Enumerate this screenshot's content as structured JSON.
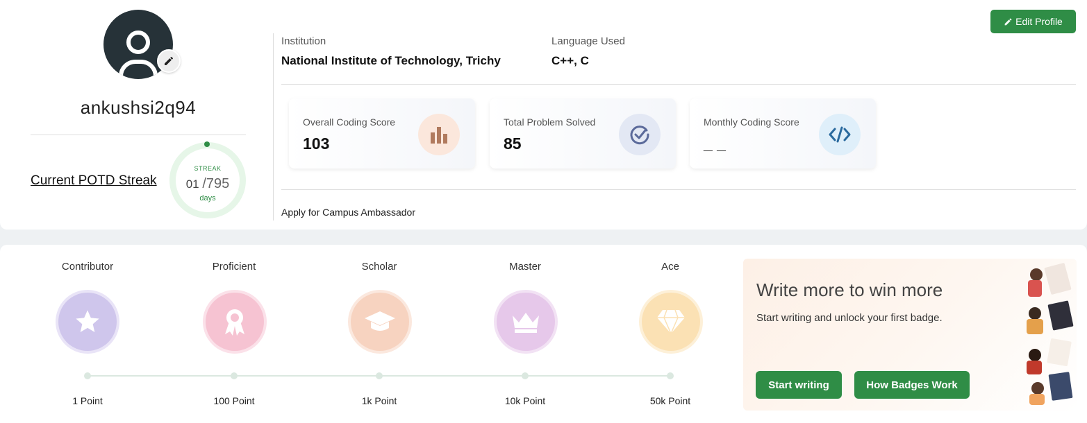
{
  "profile": {
    "username": "ankushsi2q94",
    "potd_label": "Current POTD Streak",
    "streak_label": "STREAK",
    "streak_current": "01",
    "streak_total": "/795",
    "streak_unit": "days"
  },
  "header": {
    "edit_profile_label": "Edit Profile"
  },
  "info": {
    "institution_label": "Institution",
    "institution_value": "National Institute of Technology, Trichy",
    "language_label": "Language Used",
    "language_value": "C++, C"
  },
  "stats": [
    {
      "label": "Overall Coding Score",
      "value": "103",
      "icon": "bar-chart-icon"
    },
    {
      "label": "Total Problem Solved",
      "value": "85",
      "icon": "check-circle-icon"
    },
    {
      "label": "Monthly Coding Score",
      "value": "_ _",
      "icon": "code-icon"
    }
  ],
  "campus_link": "Apply for Campus Ambassador",
  "badges": [
    {
      "name": "Contributor",
      "points": "1 Point",
      "icon": "star-icon",
      "color": "#cfc6ec"
    },
    {
      "name": "Proficient",
      "points": "100 Point",
      "icon": "ribbon-icon",
      "color": "#f6c3d2"
    },
    {
      "name": "Scholar",
      "points": "1k Point",
      "icon": "graduation-cap-icon",
      "color": "#f7d3c0"
    },
    {
      "name": "Master",
      "points": "10k Point",
      "icon": "crown-icon",
      "color": "#e6c8ea"
    },
    {
      "name": "Ace",
      "points": "50k Point",
      "icon": "diamond-icon",
      "color": "#fbe1b4"
    }
  ],
  "promo": {
    "title": "Write more to win more",
    "subtitle": "Start writing and unlock your first badge.",
    "start_writing_label": "Start writing",
    "how_badges_label": "How Badges Work"
  },
  "colors": {
    "accent": "#2f8d46",
    "avatar_bg": "#263238"
  }
}
